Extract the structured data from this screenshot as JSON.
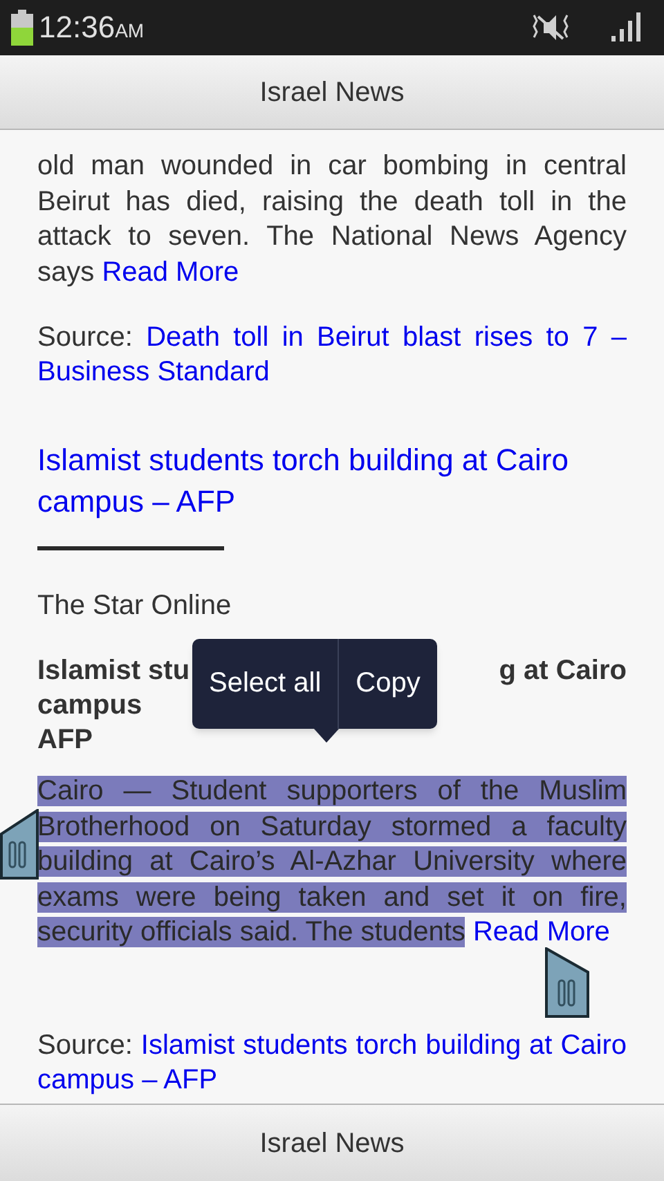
{
  "status_bar": {
    "time": "12:36",
    "time_suffix": "AM"
  },
  "title_bar": {
    "title": "Israel News"
  },
  "content": [
    {
      "kind": "paragraph",
      "text": "old man wounded in car bombing in central Beirut has died, raising the death toll in the attack to seven. The National News Agency says",
      "link": "Read More",
      "selected": false
    },
    {
      "kind": "source",
      "label": "Source:",
      "link": "Death toll in Beirut blast rises to 7 – Business Standard"
    },
    {
      "kind": "headline",
      "text": "Islamist students torch building at Cairo campus – AFP"
    },
    {
      "kind": "rule"
    },
    {
      "kind": "publisher",
      "text": "The Star Online"
    },
    {
      "kind": "bold_heading",
      "parts": [
        "Islamist stu",
        "g at Cairo"
      ],
      "lines": [
        "campus",
        "AFP"
      ]
    },
    {
      "kind": "paragraph",
      "text": "Cairo — Student supporters of the Muslim Brotherhood on Saturday stormed a faculty building at Cairo’s Al-Azhar University where exams were being taken and set it on fire, security officials said. The students",
      "link": "Read More",
      "selected": true
    },
    {
      "kind": "source",
      "label": "Source:",
      "link": "Islamist students torch building at Cairo campus – AFP"
    }
  ],
  "selection_menu": {
    "items": [
      "Select all",
      "Copy"
    ]
  },
  "bottom_bar": {
    "title": "Israel News"
  }
}
